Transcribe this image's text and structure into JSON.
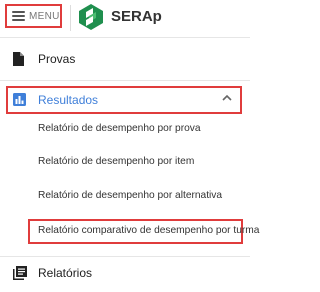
{
  "header": {
    "menu_label": "MENU",
    "brand": "SERAp",
    "logo_icon": "serap-logo-icon",
    "colors": {
      "logo_dark": "#1f8f4e",
      "logo_light": "#4cbd72",
      "highlight": "#e03c3c"
    }
  },
  "sidebar": {
    "provas": {
      "label": "Provas",
      "icon": "document-icon"
    },
    "resultados": {
      "label": "Resultados",
      "icon": "bar-chart-icon",
      "expanded_icon": "chevron-up-icon",
      "accent": "#3f7fd9",
      "subitems": [
        "Relatório de desempenho por prova",
        "Relatório de desempenho por item",
        "Relatório de desempenho por alternativa",
        "Relatório comparativo de desempenho por turma"
      ]
    },
    "relatorios": {
      "label": "Relatórios",
      "icon": "library-books-icon"
    }
  }
}
